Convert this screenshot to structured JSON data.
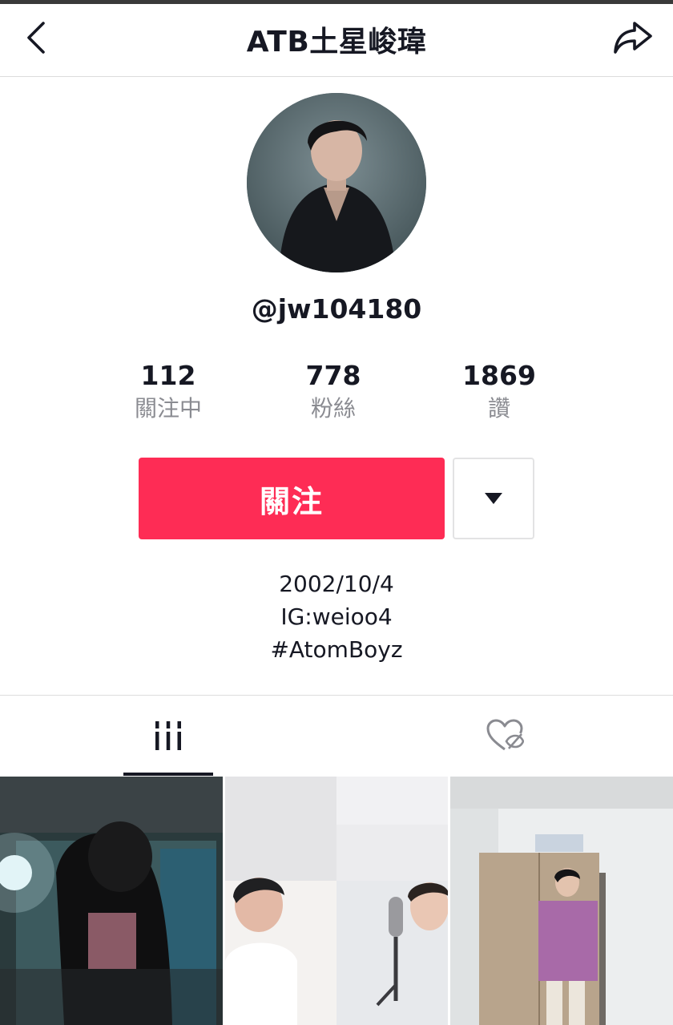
{
  "header": {
    "title": "ATB土星峻瑋",
    "back_icon": "chevron-left-icon",
    "share_icon": "share-arrow-icon"
  },
  "profile": {
    "username": "@jw104180",
    "stats": [
      {
        "value": "112",
        "label": "關注中"
      },
      {
        "value": "778",
        "label": "粉絲"
      },
      {
        "value": "1869",
        "label": "讚"
      }
    ],
    "follow_label": "關注",
    "bio": [
      "2002/10/4",
      "IG:weioo4",
      "#AtomBoyz"
    ]
  },
  "tabs": [
    {
      "name": "videos",
      "icon": "video-grid-icon",
      "active": true
    },
    {
      "name": "liked-videos",
      "icon": "heart-hidden-icon",
      "active": false
    }
  ],
  "colors": {
    "accent": "#fe2c55",
    "text": "#161823",
    "muted": "#8a8b91"
  }
}
